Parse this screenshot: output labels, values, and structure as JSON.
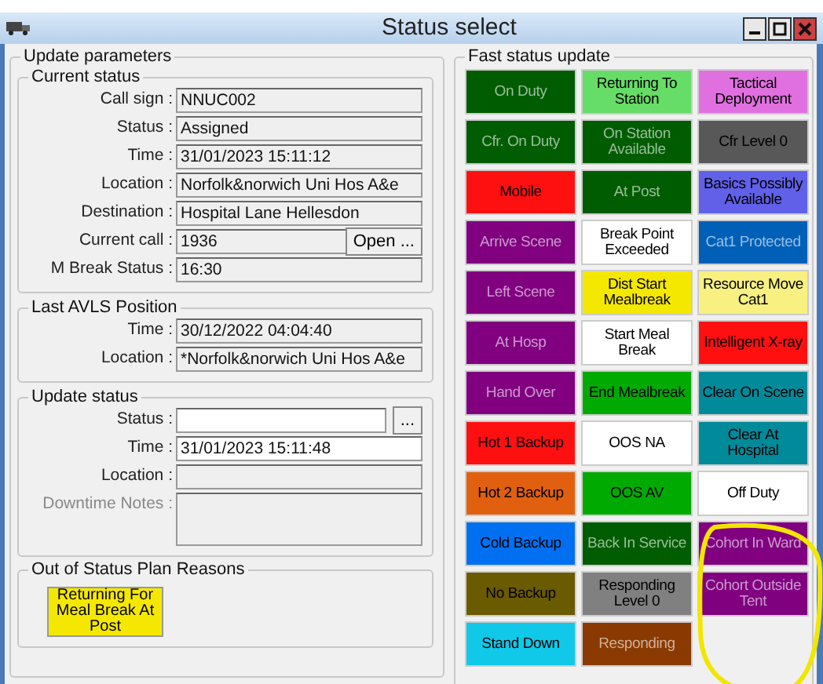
{
  "window": {
    "title": "Status select"
  },
  "update_parameters": {
    "title": "Update parameters",
    "current_status": {
      "title": "Current status",
      "fields": [
        {
          "label": "Call sign :",
          "value": "NNUC002"
        },
        {
          "label": "Status :",
          "value": "Assigned"
        },
        {
          "label": "Time :",
          "value": "31/01/2023 15:11:12"
        },
        {
          "label": "Location :",
          "value": "Norfolk&norwich Uni Hos A&e"
        },
        {
          "label": "Destination :",
          "value": "Hospital Lane Hellesdon"
        },
        {
          "label": "Current call :",
          "value": "1936",
          "button": "Open ..."
        },
        {
          "label": "M Break Status :",
          "value": "16:30"
        }
      ]
    },
    "last_avls": {
      "title": "Last AVLS Position",
      "fields": [
        {
          "label": "Time :",
          "value": "30/12/2022 04:04:40"
        },
        {
          "label": "Location :",
          "value": "*Norfolk&norwich Uni Hos A&e"
        }
      ]
    },
    "update_status": {
      "title": "Update status",
      "fields": [
        {
          "label": "Status :",
          "editable": true,
          "button": "..."
        },
        {
          "label": "Time :",
          "value": "31/01/2023 15:11:48",
          "editable": true
        },
        {
          "label": "Location :",
          "editable": false
        },
        {
          "label": "Downtime Notes :",
          "editable": false,
          "disabled": true,
          "kind": "notes"
        }
      ]
    },
    "out_of_status": {
      "title": "Out of Status Plan Reasons",
      "buttons": [
        {
          "label": "Returning For Meal Break At Post",
          "color": "#f5e800"
        }
      ]
    }
  },
  "fast_status": {
    "title": "Fast status update",
    "buttons": [
      {
        "label": "On Duty",
        "color": "#005c00"
      },
      {
        "label": "Returning To Station",
        "color": "#66dd66"
      },
      {
        "label": "Tactical Deployment",
        "color": "#e070e0"
      },
      {
        "label": "Cfr. On Duty",
        "color": "#005c00"
      },
      {
        "label": "On Station Available",
        "color": "#005c00"
      },
      {
        "label": "Cfr Level 0",
        "color": "#585858"
      },
      {
        "label": "Mobile",
        "color": "#ff1010"
      },
      {
        "label": "At Post",
        "color": "#005c00"
      },
      {
        "label": "Basics Possibly Available",
        "color": "#6060e8"
      },
      {
        "label": "Arrive Scene",
        "color": "#800080"
      },
      {
        "label": "Break Point Exceeded",
        "color": "#ffffff"
      },
      {
        "label": "Cat1 Protected",
        "color": "#0060b8"
      },
      {
        "label": "Left Scene",
        "color": "#800080"
      },
      {
        "label": "Dist Start Mealbreak",
        "color": "#f5e800"
      },
      {
        "label": "Resource Move Cat1",
        "color": "#f8f080"
      },
      {
        "label": "At Hosp",
        "color": "#800080"
      },
      {
        "label": "Start Meal Break",
        "color": "#ffffff"
      },
      {
        "label": "Intelligent X-ray",
        "color": "#ff1010"
      },
      {
        "label": "Hand Over",
        "color": "#800080"
      },
      {
        "label": "End Mealbreak",
        "color": "#00aa00"
      },
      {
        "label": "Clear On Scene",
        "color": "#008a9a"
      },
      {
        "label": "Hot 1 Backup",
        "color": "#ff1010"
      },
      {
        "label": "OOS NA",
        "color": "#ffffff"
      },
      {
        "label": "Clear At Hospital",
        "color": "#008a9a"
      },
      {
        "label": "Hot 2 Backup",
        "color": "#e06010"
      },
      {
        "label": "OOS AV",
        "color": "#00aa00"
      },
      {
        "label": "Off Duty",
        "color": "#ffffff"
      },
      {
        "label": "Cold Backup",
        "color": "#0070f0"
      },
      {
        "label": "Back In Service",
        "color": "#005c00"
      },
      {
        "label": "Cohort In Ward",
        "color": "#800080"
      },
      {
        "label": "No Backup",
        "color": "#6a5a00"
      },
      {
        "label": "Responding Level 0",
        "color": "#808080"
      },
      {
        "label": "Cohort Outside Tent",
        "color": "#800080"
      },
      {
        "label": "Stand Down",
        "color": "#10c8e8"
      },
      {
        "label": "Responding",
        "color": "#8a3a00"
      }
    ]
  }
}
